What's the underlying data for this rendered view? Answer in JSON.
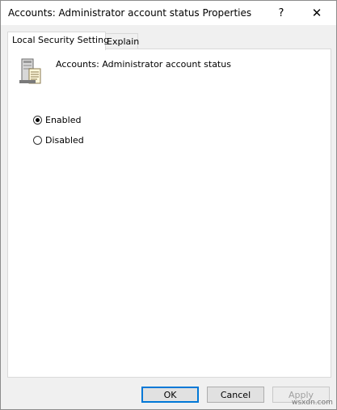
{
  "window": {
    "title": "Accounts: Administrator account status Properties",
    "help_label": "?",
    "close_label": "✕"
  },
  "tabs": [
    {
      "label": "Local Security Setting",
      "active": true
    },
    {
      "label": "Explain",
      "active": false
    }
  ],
  "policy": {
    "name": "Accounts: Administrator account status",
    "icon": "server-policy-icon"
  },
  "options": {
    "enabled_label": "Enabled",
    "disabled_label": "Disabled",
    "selected": "Enabled"
  },
  "buttons": {
    "ok": "OK",
    "cancel": "Cancel",
    "apply": "Apply"
  },
  "watermark": "wsxdn.com",
  "colors": {
    "accent": "#0078d7",
    "panel_bg": "#ffffff",
    "window_bg": "#f0f0f0"
  }
}
